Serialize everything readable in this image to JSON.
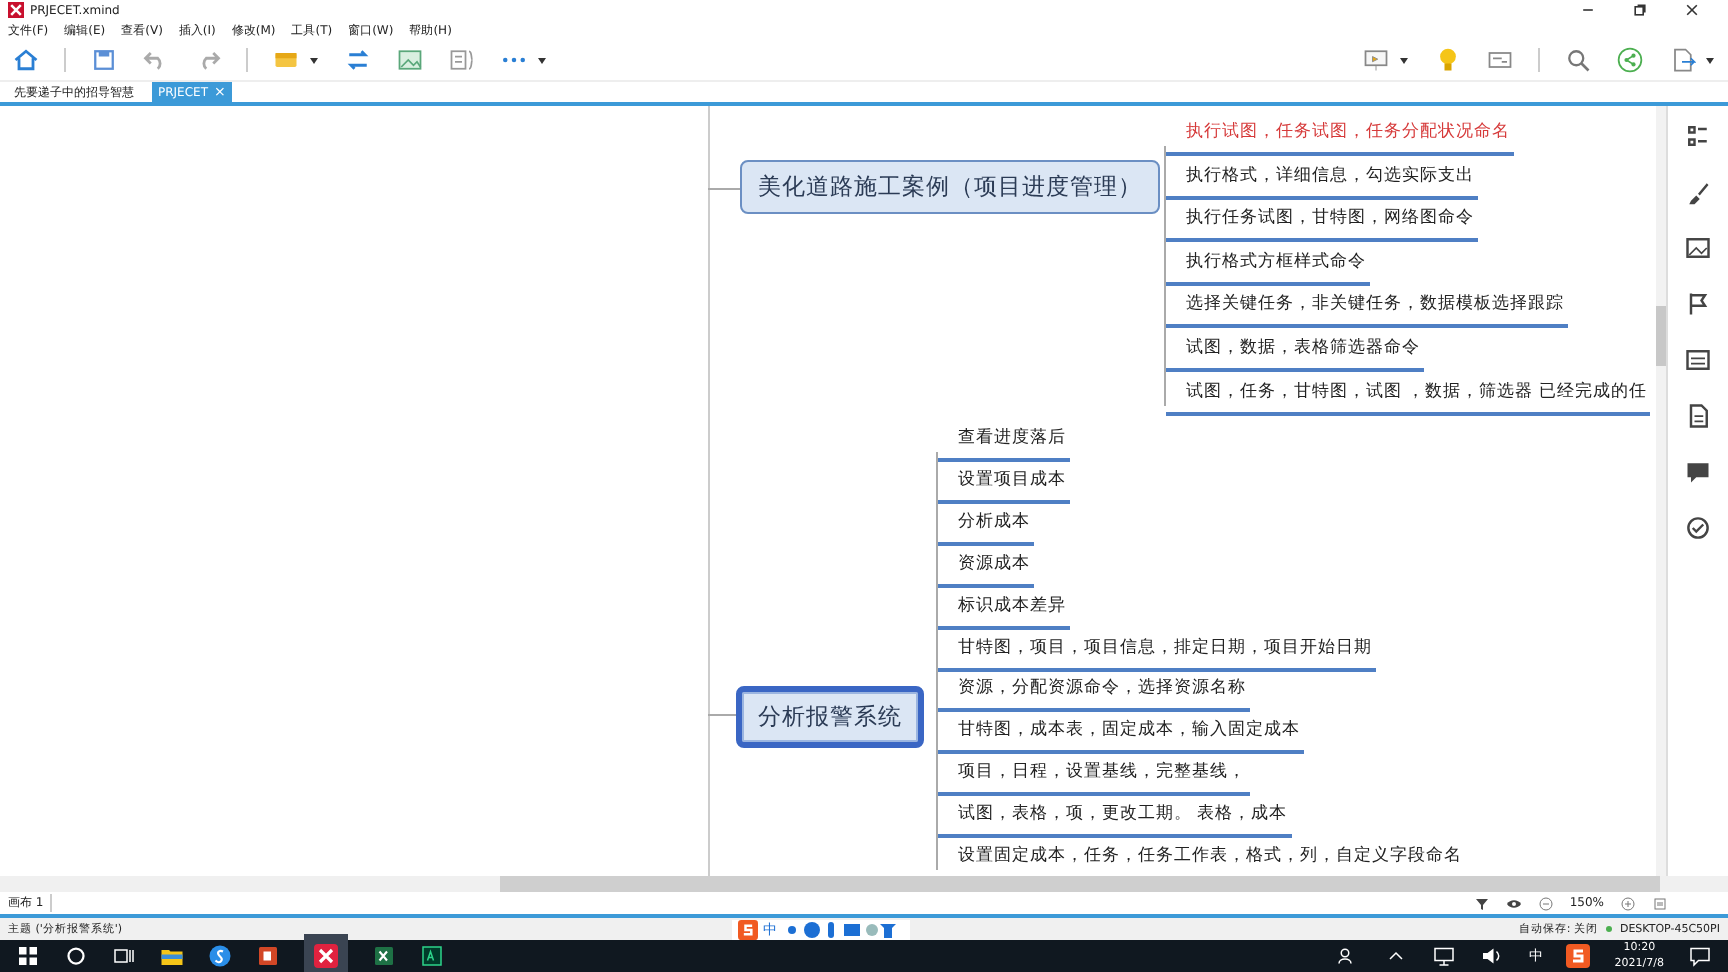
{
  "window": {
    "title": "PRJECET.xmind"
  },
  "menu": [
    "文件(F)",
    "编辑(E)",
    "查看(V)",
    "插入(I)",
    "修改(M)",
    "工具(T)",
    "窗口(W)",
    "帮助(H)"
  ],
  "tabs": [
    {
      "label": "先要递子中的招导智慧",
      "selected": false
    },
    {
      "label": "PRJECET",
      "selected": true,
      "close": "×"
    }
  ],
  "topics": [
    {
      "title": "美化道路施工案例（项目进度管理）",
      "selected": false,
      "children": [
        {
          "text": "执行试图，任务试图，任务分配状况命名",
          "color": "#d63a3a"
        },
        {
          "text": "执行格式，详细信息，勾选实际支出",
          "color": "#222222"
        },
        {
          "text": "执行任务试图，甘特图，网络图命令",
          "color": "#222222"
        },
        {
          "text": "执行格式方框样式命令",
          "color": "#222222"
        },
        {
          "text": "选择关键任务，非关键任务，数据模板选择跟踪",
          "color": "#222222"
        },
        {
          "text": "试图，数据，表格筛选器命令",
          "color": "#222222"
        },
        {
          "text": "试图，任务，甘特图，试图 ，数据，筛选器  已经完成的任",
          "color": "#222222"
        }
      ]
    },
    {
      "title": "分析报警系统",
      "selected": true,
      "children": [
        {
          "text": "查看进度落后",
          "color": "#222222"
        },
        {
          "text": "设置项目成本",
          "color": "#222222"
        },
        {
          "text": "分析成本",
          "color": "#222222"
        },
        {
          "text": "资源成本",
          "color": "#222222"
        },
        {
          "text": "标识成本差异",
          "color": "#222222"
        },
        {
          "text": "甘特图，项目，项目信息，排定日期，项目开始日期",
          "color": "#222222"
        },
        {
          "text": "资源，分配资源命令，选择资源名称",
          "color": "#222222"
        },
        {
          "text": "甘特图，成本表，固定成本，输入固定成本",
          "color": "#222222"
        },
        {
          "text": "项目，日程，设置基线，完整基线，",
          "color": "#222222"
        },
        {
          "text": "试图，表格，项，更改工期。 表格，成本",
          "color": "#222222"
        },
        {
          "text": "设置固定成本，任务，任务工作表，格式，列，自定义字段命名",
          "color": "#222222"
        }
      ]
    }
  ],
  "sheet_tab": "画布 1",
  "zoom": "150%",
  "status_bar": {
    "left": "主题 ('分析报警系统')",
    "autosave": "自动保存: 关闭",
    "computer": "DESKTOP-45C50PI"
  },
  "ime": "中",
  "taskbar": {
    "lang": "中",
    "time": "10:20",
    "date": "2021/7/8"
  }
}
